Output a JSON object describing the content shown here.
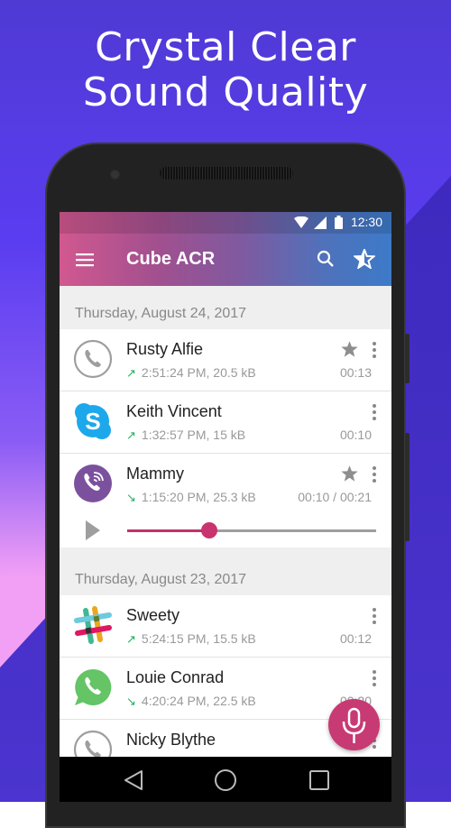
{
  "promo": {
    "headline_line1": "Crystal Clear",
    "headline_line2": "Sound Quality"
  },
  "colors": {
    "accent": "#c8346f",
    "incoming_arrow": "#1fb25a",
    "appbar_start": "#d1588f",
    "appbar_end": "#3d7ac8"
  },
  "status_bar": {
    "time": "12:30",
    "icons": [
      "wifi-icon",
      "signal-icon",
      "battery-icon"
    ]
  },
  "app_bar": {
    "title": "Cube ACR",
    "menu_icon": "hamburger-menu-icon",
    "search_icon": "search-icon",
    "favorites_icon": "star-outline-icon"
  },
  "sections": [
    {
      "date": "Thursday, August 24, 2017",
      "recordings": [
        {
          "name": "Rusty Alfie",
          "direction": "outgoing",
          "arrow": "↗",
          "meta": "2:51:24 PM, 20.5 kB",
          "duration": "00:13",
          "starred": true,
          "app_icon": "phone-icon"
        },
        {
          "name": "Keith Vincent",
          "direction": "outgoing",
          "arrow": "↗",
          "meta": "1:32:57 PM, 15 kB",
          "duration": "00:10",
          "starred": false,
          "app_icon": "skype-icon"
        },
        {
          "name": "Mammy",
          "direction": "incoming",
          "arrow": "↘",
          "meta": "1:15:20 PM, 25.3 kB",
          "duration": "00:10 / 00:21",
          "starred": true,
          "app_icon": "viber-icon",
          "playing": true,
          "progress_percent": 33
        }
      ]
    },
    {
      "date": "Thursday, August 23, 2017",
      "recordings": [
        {
          "name": "Sweety",
          "direction": "outgoing",
          "arrow": "↗",
          "meta": "5:24:15 PM, 15.5 kB",
          "duration": "00:12",
          "starred": false,
          "app_icon": "slack-icon"
        },
        {
          "name": "Louie Conrad",
          "direction": "incoming",
          "arrow": "↘",
          "meta": "4:20:24 PM, 22.5 kB",
          "duration": "00:20",
          "starred": false,
          "app_icon": "whatsapp-icon"
        },
        {
          "name": "Nicky Blythe",
          "direction": "",
          "arrow": "",
          "meta": "",
          "duration": "",
          "starred": false,
          "app_icon": "phone-icon"
        }
      ]
    }
  ],
  "fab": {
    "icon": "microphone-icon"
  },
  "nav_bar": {
    "back": "back-icon",
    "home": "home-icon",
    "recents": "recents-icon"
  }
}
